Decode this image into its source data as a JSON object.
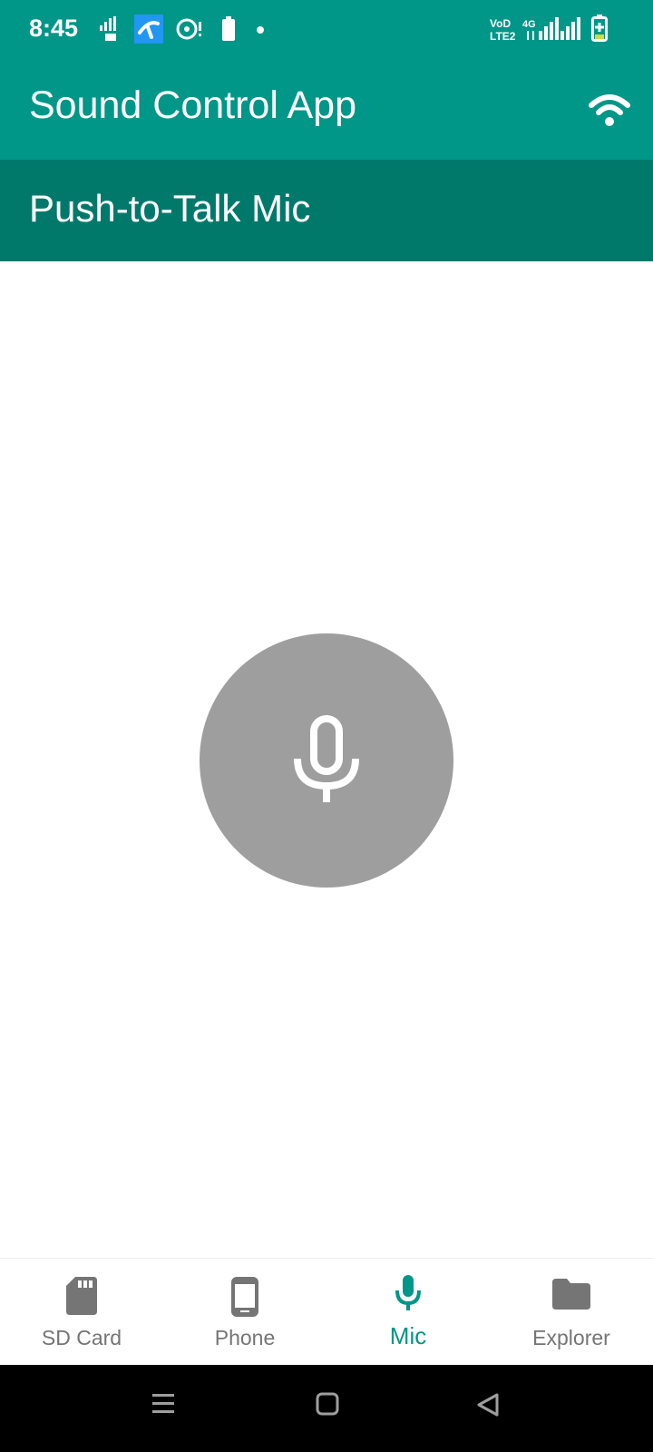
{
  "status_bar": {
    "time": "8:45",
    "left_icons": [
      "sim-data-icon",
      "telenor-app-icon",
      "sync-alert-icon",
      "battery-small-icon",
      "dot-icon"
    ],
    "right_icons": [
      "volte-icon",
      "4g-signal-icon",
      "signal-bars-icon",
      "battery-charging-icon"
    ],
    "volte_label": "Vo LTE",
    "network_label": "4G"
  },
  "app_bar": {
    "title": "Sound Control App",
    "action_icon": "wifi-icon"
  },
  "section": {
    "title": "Push-to-Talk Mic"
  },
  "mic_button": {
    "icon": "microphone-icon",
    "state_color": "#9e9e9e"
  },
  "bottom_nav": {
    "items": [
      {
        "label": "SD Card",
        "icon": "sd-card-icon",
        "active": false
      },
      {
        "label": "Phone",
        "icon": "phone-icon",
        "active": false
      },
      {
        "label": "Mic",
        "icon": "microphone-icon",
        "active": true
      },
      {
        "label": "Explorer",
        "icon": "folder-icon",
        "active": false
      }
    ]
  },
  "colors": {
    "primary": "#009688",
    "primary_dark": "#00796b",
    "inactive": "#757575",
    "mic_bg": "#9e9e9e"
  }
}
